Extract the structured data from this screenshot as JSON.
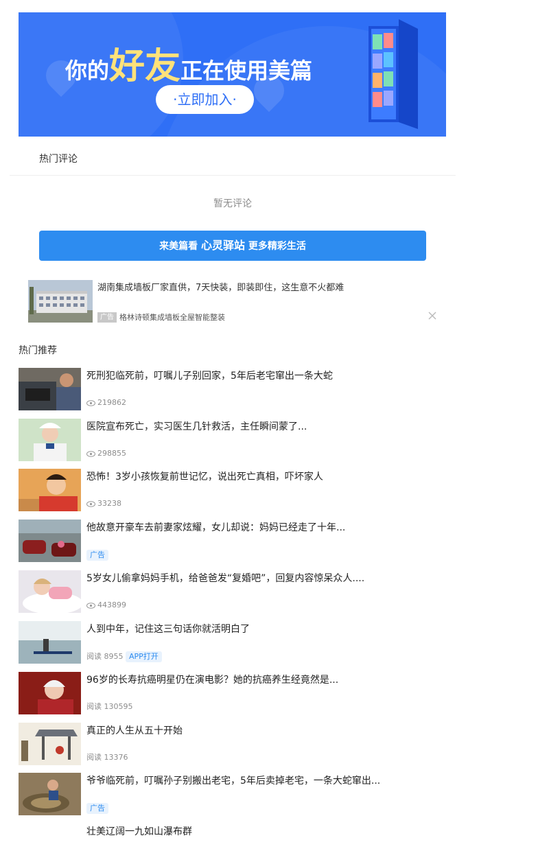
{
  "banner": {
    "headline_part1": "你的",
    "headline_highlight": "好友",
    "headline_part2": "正在使用美篇",
    "join_label": "·立即加入·"
  },
  "comments": {
    "title": "热门评论",
    "empty_text": "暂无评论"
  },
  "cta": {
    "prefix": "来美篇看",
    "highlight": "心灵驿站",
    "suffix": "更多精彩生活"
  },
  "ad": {
    "title": "湖南集成墙板厂家直供，7天快装，即装即住，这生意不火都难",
    "badge": "广告",
    "source": "格林诗顿集成墙板全屋智能整装"
  },
  "recommend": {
    "title": "热门推荐",
    "items": [
      {
        "title": "死刑犯临死前，叮嘱儿子别回家，5年后老宅窜出一条大蛇",
        "views": "219862"
      },
      {
        "title": "医院宣布死亡，实习医生几针救活，主任瞬间蒙了...",
        "views": "298855"
      },
      {
        "title": "恐怖！3岁小孩恢复前世记忆，说出死亡真相，吓坏家人",
        "views": "33238"
      },
      {
        "title": "他故意开豪车去前妻家炫耀，女儿却说：妈妈已经走了十年...",
        "tag": "广告"
      },
      {
        "title": "5岁女儿偷拿妈妈手机，给爸爸发“复婚吧”，回复内容惊呆众人....",
        "views": "443899"
      },
      {
        "title": "人到中年，记住这三句话你就活明白了",
        "reads": "阅读 8955",
        "tag": "APP打开"
      },
      {
        "title": "96岁的长寿抗癌明星仍在演电影？她的抗癌养生经竟然是...",
        "reads": "阅读 130595"
      },
      {
        "title": "真正的人生从五十开始",
        "reads": "阅读 13376"
      },
      {
        "title": "爷爷临死前，叮嘱孙子别搬出老宅，5年后卖掉老宅，一条大蛇窜出...",
        "tag": "广告"
      }
    ],
    "last_title": "壮美辽阔一九如山瀑布群"
  }
}
